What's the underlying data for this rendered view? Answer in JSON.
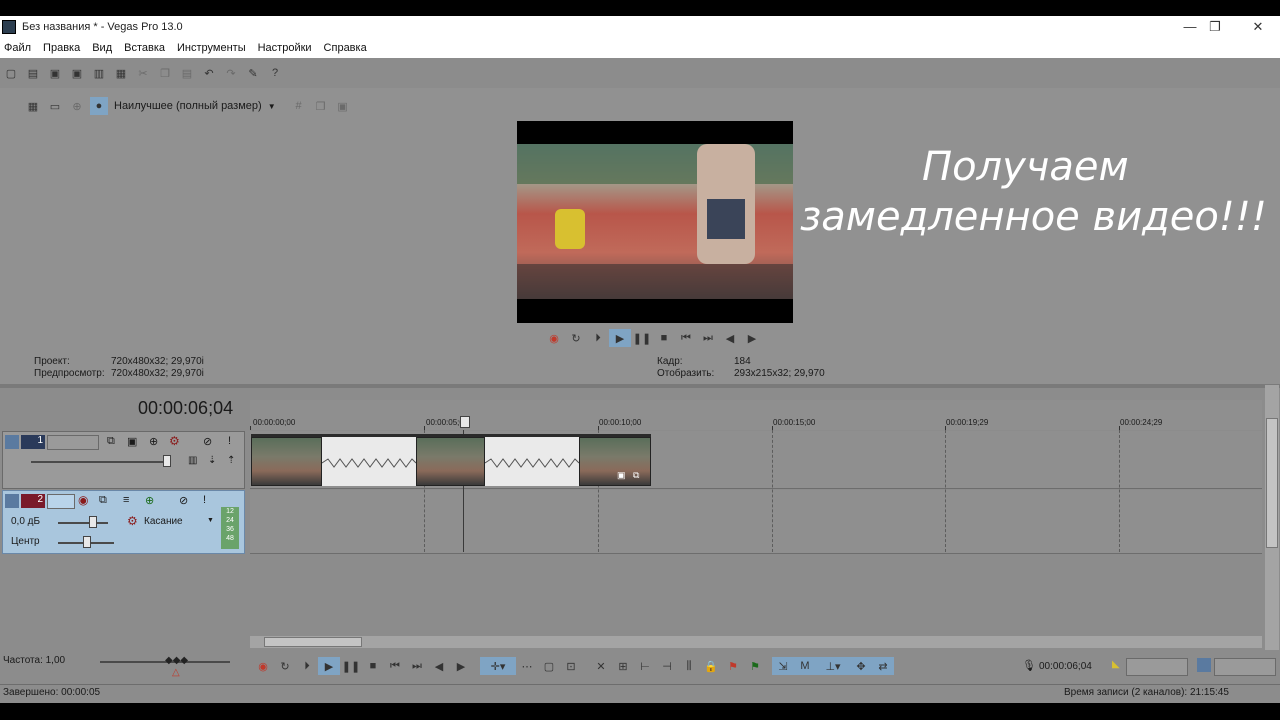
{
  "window": {
    "title": "Без названия * - Vegas Pro 13.0",
    "controls": {
      "minimize": "—",
      "restore": "❐",
      "close": "✕"
    }
  },
  "menu": [
    "Файл",
    "Правка",
    "Вид",
    "Вставка",
    "Инструменты",
    "Настройки",
    "Справка"
  ],
  "preview": {
    "quality": "Наилучшее (полный размер)",
    "project_label": "Проект:",
    "project_value": "720x480x32; 29,970i",
    "preview_label": "Предпросмотр:",
    "preview_value": "720x480x32; 29,970i",
    "frame_label": "Кадр:",
    "frame_value": "184",
    "display_label": "Отобразить:",
    "display_value": "293x215x32; 29,970"
  },
  "overlay": {
    "line1": "Получаем",
    "line2": "замедленное видео!!!"
  },
  "timeline": {
    "timecode": "00:00:06;04",
    "ruler": [
      "00:00:00;00",
      "00:00:05;00",
      "00:00:10;00",
      "00:00:15;00",
      "00:00:19;29",
      "00:00:24;29"
    ]
  },
  "tracks": {
    "video": {
      "number": "1"
    },
    "audio": {
      "number": "2",
      "volume": "0,0 дБ",
      "pan": "Центр",
      "automation": "Касание",
      "meter": [
        "12",
        "24",
        "36",
        "48"
      ]
    }
  },
  "bottom": {
    "rate": "Частота: 1,00",
    "cursor_time": "00:00:06;04",
    "status_left": "Завершено: 00:00:05",
    "status_right": "Время записи (2 каналов): 21:15:45"
  },
  "colors": {
    "panel": "#8c8c8c",
    "track_audio": "#a9c6dd",
    "accent": "#7fa4c4",
    "record": "#c0392b"
  }
}
